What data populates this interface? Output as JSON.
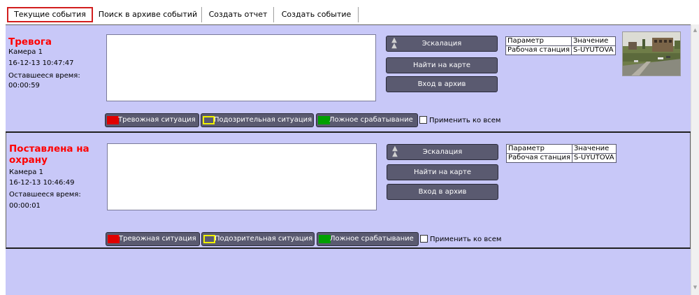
{
  "tabs": [
    {
      "label": "Текущие события"
    },
    {
      "label": "Поиск в архиве событий"
    },
    {
      "label": "Создать отчет"
    },
    {
      "label": "Создать событие"
    }
  ],
  "events": [
    {
      "title": "Тревога",
      "camera": "Камера 1",
      "timestamp": "16-12-13 10:47:47",
      "remaining_label": "Оставшееся время:",
      "remaining_time": "00:00:59",
      "escalate_label": "Эскалация",
      "map_label": "Найти на карте",
      "archive_label": "Вход в архив",
      "param_header": "Параметр",
      "value_header": "Значение",
      "param_name": "Рабочая станция",
      "param_value": "S-UYUTOVA",
      "classify": {
        "alarm": "Тревожная ситуация",
        "suspicious": "Подозрительная ситуация",
        "false_alarm": "Ложное срабатывание"
      },
      "apply_all_label": "Применить ко всем"
    },
    {
      "title": "Поставлена на охрану",
      "camera": "Камера 1",
      "timestamp": "16-12-13 10:46:49",
      "remaining_label": "Оставшееся время:",
      "remaining_time": "00:00:01",
      "escalate_label": "Эскалация",
      "map_label": "Найти на карте",
      "archive_label": "Вход в архив",
      "param_header": "Параметр",
      "value_header": "Значение",
      "param_name": "Рабочая станция",
      "param_value": "S-UYUTOVA",
      "classify": {
        "alarm": "Тревожная ситуация",
        "suspicious": "Подозрительная ситуация",
        "false_alarm": "Ложное срабатывание"
      },
      "apply_all_label": "Применить ко всем"
    }
  ],
  "colors": {
    "title_red": "#ff0000",
    "active_tab_border": "#d21e1e",
    "panel_bg": "#c8c8f8",
    "button_bg": "#5a5a70",
    "alarm_swatch": "#e00000",
    "suspicious_swatch": "#f0f000",
    "false_swatch": "#00a000"
  }
}
